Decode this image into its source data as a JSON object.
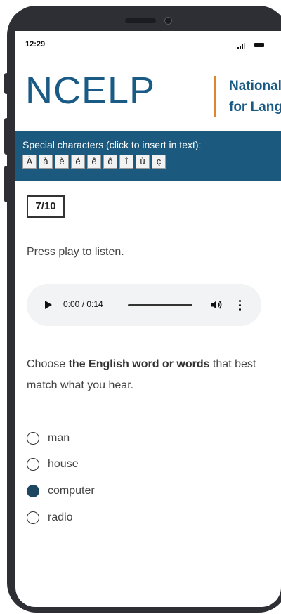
{
  "status": {
    "time": "12:29"
  },
  "logo": {
    "main": "NCELP",
    "sub1": "National Centre",
    "sub2": "for Languages"
  },
  "special_chars": {
    "title": "Special characters (click to insert in text):",
    "chars": [
      "À",
      "à",
      "è",
      "é",
      "ê",
      "ô",
      "î",
      "ù",
      "ç"
    ]
  },
  "counter": "7/10",
  "prompt": "Press play to listen.",
  "audio": {
    "time": "0:00 / 0:14"
  },
  "question": {
    "pre": "Choose ",
    "bold": "the English word or words",
    "post": " that best match what you hear."
  },
  "options": [
    {
      "label": "man",
      "selected": false
    },
    {
      "label": "house",
      "selected": false
    },
    {
      "label": "computer",
      "selected": true
    },
    {
      "label": "radio",
      "selected": false
    }
  ],
  "colors": {
    "brand": "#1a5b86",
    "accent": "#e0862a",
    "banner": "#1b5a7e",
    "radio_selected": "#1d4660"
  }
}
